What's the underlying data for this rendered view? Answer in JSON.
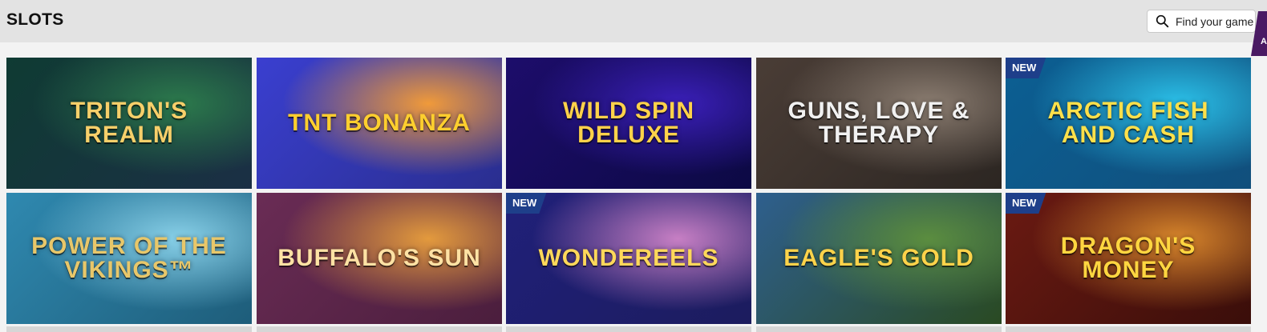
{
  "header": {
    "title": "SLOTS",
    "search_placeholder": "Find your game",
    "corner_label": "A"
  },
  "games": [
    {
      "name": "TRITON'S REALM",
      "new": false,
      "bg": [
        "#0f3b33",
        "#2c7a4c",
        "#1b2f45"
      ],
      "text": "#f6cf6a"
    },
    {
      "name": "TNT BONANZA",
      "new": false,
      "bg": [
        "#3a3fd0",
        "#f09a3a",
        "#2a2e8f"
      ],
      "text": "#ffcf2e"
    },
    {
      "name": "WILD Spin Deluxe",
      "new": false,
      "bg": [
        "#1d0d6b",
        "#3a1fb8",
        "#0c0944"
      ],
      "text": "#ffd24a"
    },
    {
      "name": "GUNS, LOVE & THERAPY",
      "new": false,
      "bg": [
        "#4a3d36",
        "#8a7c70",
        "#2c2622"
      ],
      "text": "#f1f1f1"
    },
    {
      "name": "ARCTIC FISH AND CASH",
      "new": true,
      "bg": [
        "#0b5f93",
        "#2bc0e8",
        "#114f7c"
      ],
      "text": "#ffe04a"
    },
    {
      "name": "POWER OF THE VIKINGS™",
      "new": false,
      "bg": [
        "#2f89b0",
        "#88d0e8",
        "#1e5d7a"
      ],
      "text": "#e8c76a"
    },
    {
      "name": "BUFFALO'S SUN",
      "new": false,
      "bg": [
        "#6a2c55",
        "#e39a3d",
        "#4b1e3d"
      ],
      "text": "#ffe2a4"
    },
    {
      "name": "WondeReels",
      "new": true,
      "bg": [
        "#20207a",
        "#c77fc4",
        "#1c1c5e"
      ],
      "text": "#ffd85a"
    },
    {
      "name": "EAGLE'S GOLD",
      "new": false,
      "bg": [
        "#2e5f8e",
        "#5b8d3f",
        "#2a4a22"
      ],
      "text": "#ffd34a"
    },
    {
      "name": "DRAGON'S MONEY",
      "new": true,
      "bg": [
        "#6b1a12",
        "#d6852b",
        "#3a0e0a"
      ],
      "text": "#ffd640"
    }
  ],
  "badge_text": "NEW"
}
